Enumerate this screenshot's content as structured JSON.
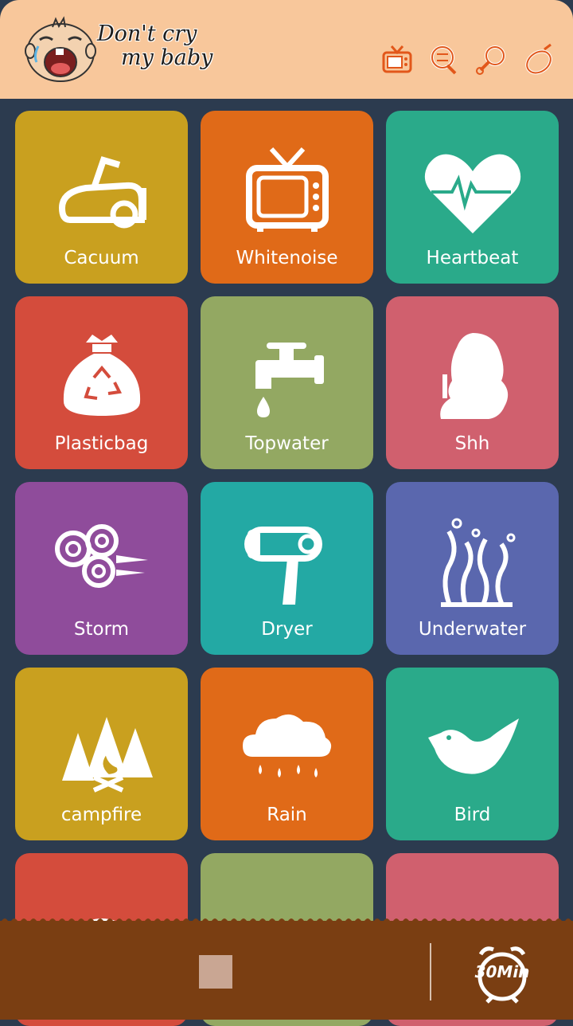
{
  "app": {
    "logo_line1": "Don't cry",
    "logo_line2": "my baby"
  },
  "header_icons": [
    "tv-icon",
    "rattle-icon",
    "pacifier-icon",
    "bottle-icon"
  ],
  "tiles": [
    {
      "label": "Cacuum",
      "icon": "vacuum-icon",
      "color": "#c9a01f"
    },
    {
      "label": "Whitenoise",
      "icon": "tv-icon",
      "color": "#e06a18"
    },
    {
      "label": "Heartbeat",
      "icon": "heart-icon",
      "color": "#2aaa8a"
    },
    {
      "label": "Plasticbag",
      "icon": "bag-icon",
      "color": "#d44c3c"
    },
    {
      "label": "Topwater",
      "icon": "faucet-icon",
      "color": "#93a862"
    },
    {
      "label": "Shh",
      "icon": "woman-shh-icon",
      "color": "#d0606e"
    },
    {
      "label": "Storm",
      "icon": "wind-icon",
      "color": "#8f4c9b"
    },
    {
      "label": "Dryer",
      "icon": "hair-dryer-icon",
      "color": "#23a9a4"
    },
    {
      "label": "Underwater",
      "icon": "seaweed-icon",
      "color": "#5a67ae"
    },
    {
      "label": "campfire",
      "icon": "campfire-icon",
      "color": "#c9a01f"
    },
    {
      "label": "Rain",
      "icon": "rain-icon",
      "color": "#e06a18"
    },
    {
      "label": "Bird",
      "icon": "bird-icon",
      "color": "#2aaa8a"
    },
    {
      "label": "",
      "icon": "clock-icon",
      "color": "#d44c3c"
    },
    {
      "label": "",
      "icon": "unknown-icon",
      "color": "#93a862"
    },
    {
      "label": "",
      "icon": "teapot-icon",
      "color": "#d0606e"
    }
  ],
  "footer": {
    "timer_label": "30Min"
  }
}
